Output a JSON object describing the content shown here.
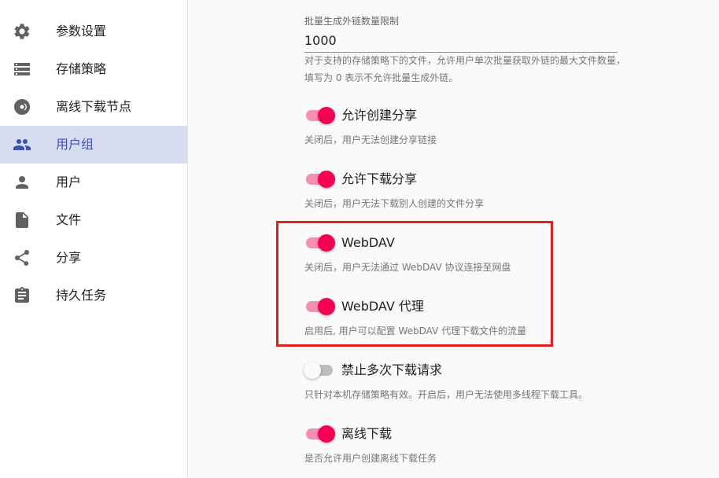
{
  "sidebar": {
    "items": [
      {
        "label": "参数设置",
        "icon": "gear-icon"
      },
      {
        "label": "存储策略",
        "icon": "storage-list-icon"
      },
      {
        "label": "离线下载节点",
        "icon": "radio-node-icon"
      },
      {
        "label": "用户组",
        "icon": "people-icon",
        "selected": true
      },
      {
        "label": "用户",
        "icon": "person-icon"
      },
      {
        "label": "文件",
        "icon": "file-icon"
      },
      {
        "label": "分享",
        "icon": "share-icon"
      },
      {
        "label": "持久任务",
        "icon": "clipboard-icon"
      }
    ]
  },
  "batch_limit": {
    "label": "批量生成外链数量限制",
    "value": "1000",
    "helper": "对于支持的存储策略下的文件，允许用户单次批量获取外链的最大文件数量，填写为 0 表示不允许批量生成外链。"
  },
  "toggles": [
    {
      "label": "允许创建分享",
      "helper": "关闭后，用户无法创建分享链接",
      "on": true
    },
    {
      "label": "允许下载分享",
      "helper": "关闭后，用户无法下载别人创建的文件分享",
      "on": true
    },
    {
      "label": "WebDAV",
      "helper": "关闭后，用户无法通过 WebDAV 协议连接至网盘",
      "on": true
    },
    {
      "label": "WebDAV 代理",
      "helper": "启用后, 用户可以配置 WebDAV 代理下载文件的流量",
      "on": true
    },
    {
      "label": "禁止多次下载请求",
      "helper": "只针对本机存储策略有效。开启后，用户无法使用多线程下载工具。",
      "on": false
    },
    {
      "label": "离线下载",
      "helper": "是否允许用户创建离线下载任务",
      "on": true
    }
  ],
  "colors": {
    "accent": "#f50057",
    "accent_track": "#f48fb1",
    "selected_bg": "#d8dcf0",
    "selected_text": "#3f51b5",
    "highlight_border": "#e02020"
  }
}
